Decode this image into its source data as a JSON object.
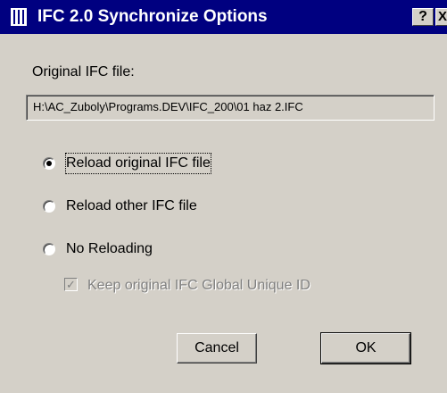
{
  "window": {
    "title": "IFC 2.0 Synchronize Options",
    "help_label": "?",
    "close_label": "X",
    "app_icon": "app-icon"
  },
  "original_file": {
    "label": "Original IFC file:",
    "path": "H:\\AC_Zuboly\\Programs.DEV\\IFC_200\\01 haz 2.IFC"
  },
  "options": [
    {
      "label": "Reload original IFC file",
      "selected": true
    },
    {
      "label": "Reload other IFC file",
      "selected": false
    },
    {
      "label": "No Reloading",
      "selected": false
    }
  ],
  "keep_guid": {
    "label": "Keep original IFC Global Unique ID",
    "checked": true,
    "enabled": false
  },
  "buttons": {
    "cancel": "Cancel",
    "ok": "OK"
  },
  "colors": {
    "title_bar": "#000080",
    "dialog_face": "#d4d0c8",
    "disabled_text": "#808080"
  }
}
